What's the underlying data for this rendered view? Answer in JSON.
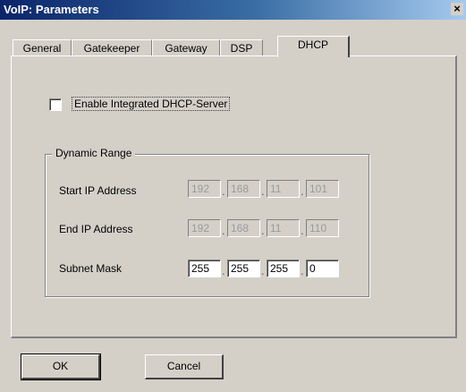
{
  "window": {
    "title": "VoIP: Parameters",
    "close_glyph": "×"
  },
  "tabs": [
    {
      "label": "General"
    },
    {
      "label": "Gatekeeper"
    },
    {
      "label": "Gateway"
    },
    {
      "label": "DSP"
    },
    {
      "label": "DHCP"
    }
  ],
  "active_tab": "DHCP",
  "dhcp": {
    "enable_label": "Enable Integrated DHCP-Server",
    "enabled": false,
    "group_title": "Dynamic Range",
    "rows": [
      {
        "label": "Start IP Address",
        "octets": [
          "192",
          "168",
          "11",
          "101"
        ],
        "editable": false
      },
      {
        "label": "End IP Address",
        "octets": [
          "192",
          "168",
          "11",
          "110"
        ],
        "editable": false
      },
      {
        "label": "Subnet Mask",
        "octets": [
          "255",
          "255",
          "255",
          "0"
        ],
        "editable": true
      }
    ]
  },
  "buttons": {
    "ok": "OK",
    "cancel": "Cancel"
  }
}
